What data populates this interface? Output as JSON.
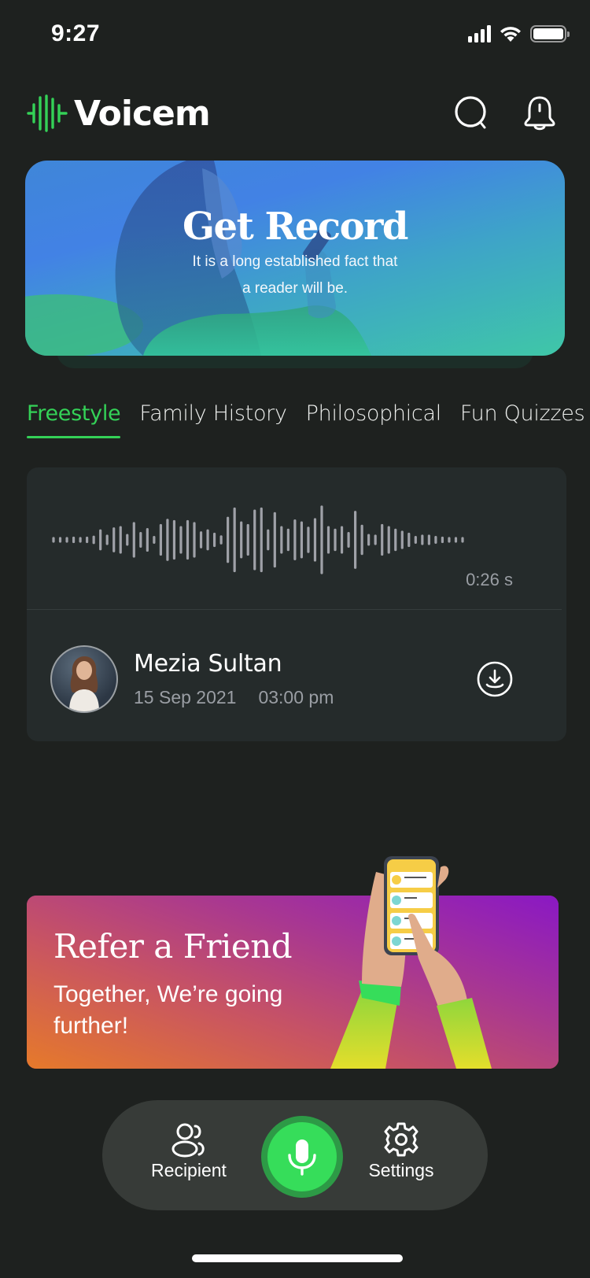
{
  "status_bar": {
    "time": "9:27"
  },
  "header": {
    "app_name": "Voicem",
    "icons": [
      "search-icon",
      "bell-icon"
    ]
  },
  "colors": {
    "accent": "#34d157",
    "background": "#1e211f",
    "card": "#252b2b",
    "muted_text": "#9a9ea4",
    "nav_bg": "#373b38"
  },
  "banner": {
    "title": "Get Record",
    "subtitle_line1": "It is a long established fact that",
    "subtitle_line2": "a reader will be."
  },
  "tabs": [
    {
      "label": "Freestyle",
      "active": true
    },
    {
      "label": "Family History",
      "active": false
    },
    {
      "label": "Philosophical",
      "active": false
    },
    {
      "label": "Fun Quizzes",
      "active": false
    }
  ],
  "recording": {
    "duration": "0:26 s",
    "waveform_levels": [
      0.04,
      0.04,
      0.04,
      0.06,
      0.04,
      0.06,
      0.09,
      0.28,
      0.12,
      0.34,
      0.38,
      0.14,
      0.5,
      0.2,
      0.32,
      0.08,
      0.44,
      0.6,
      0.56,
      0.38,
      0.56,
      0.5,
      0.22,
      0.28,
      0.18,
      0.1,
      0.66,
      0.94,
      0.52,
      0.44,
      0.88,
      0.94,
      0.28,
      0.8,
      0.38,
      0.3,
      0.58,
      0.52,
      0.36,
      0.62,
      1.0,
      0.38,
      0.3,
      0.38,
      0.2,
      0.84,
      0.42,
      0.14,
      0.12,
      0.44,
      0.38,
      0.3,
      0.24,
      0.18,
      0.08,
      0.12,
      0.12,
      0.08,
      0.06,
      0.04,
      0.04,
      0.04
    ],
    "user": {
      "name": "Mezia Sultan",
      "date": "15 Sep 2021",
      "time": "03:00 pm"
    },
    "download_icon": "download-icon"
  },
  "refer": {
    "title": "Refer a Friend",
    "subtitle_line1": "Together, We’re going",
    "subtitle_line2": "further!"
  },
  "bottom_nav": {
    "recipient_label": "Recipient",
    "settings_label": "Settings",
    "record_icon": "microphone-icon"
  }
}
